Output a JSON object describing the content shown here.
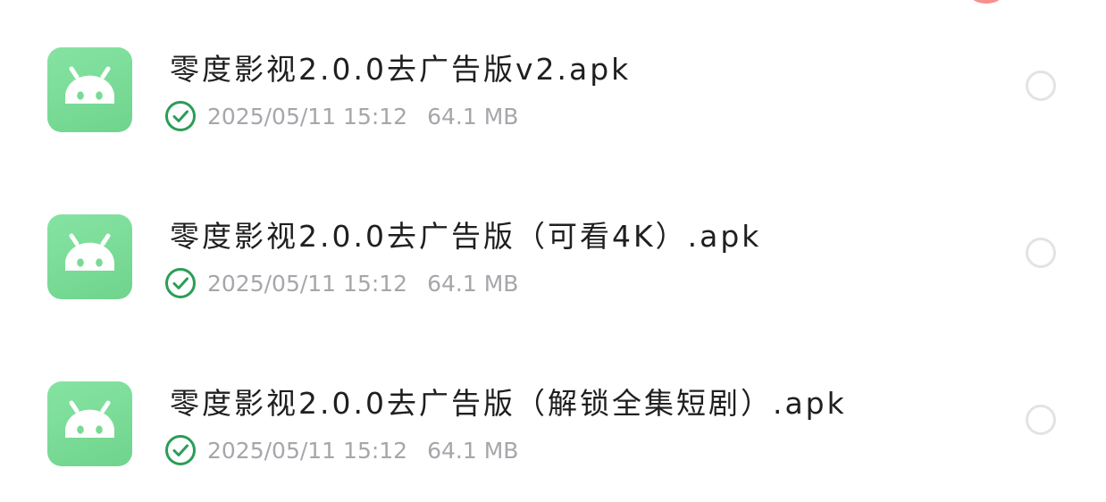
{
  "colors": {
    "accent_green": "#2a9d56",
    "icon_bg": "#79da96",
    "meta_text": "#a6a6ab",
    "radio_border": "#e3e3e6"
  },
  "files": [
    {
      "icon": "android-icon",
      "name": "零度影视2.0.0去广告版v2.apk",
      "status_icon": "check-circle-icon",
      "date": "2025/05/11 15:12",
      "size": "64.1 MB"
    },
    {
      "icon": "android-icon",
      "name": "零度影视2.0.0去广告版（可看4K）.apk",
      "status_icon": "check-circle-icon",
      "date": "2025/05/11 15:12",
      "size": "64.1 MB"
    },
    {
      "icon": "android-icon",
      "name": "零度影视2.0.0去广告版（解锁全集短剧）.apk",
      "status_icon": "check-circle-icon",
      "date": "2025/05/11 15:12",
      "size": "64.1 MB"
    }
  ]
}
